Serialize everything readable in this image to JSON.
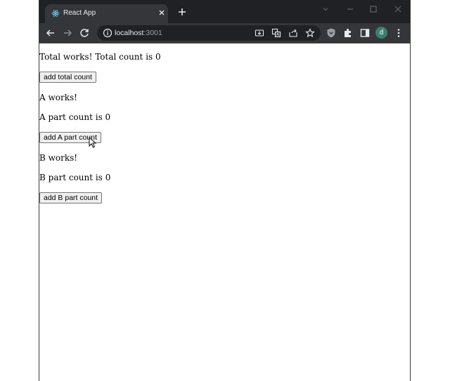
{
  "browser": {
    "tab": {
      "title": "React App"
    },
    "address": {
      "host": "localhost",
      "port": ":3001"
    },
    "profile": {
      "initial": "d",
      "color": "#3a7f6f"
    },
    "theme": {
      "frame": "#202124",
      "toolbar": "#35363a",
      "text": "#e8eaed"
    }
  },
  "app": {
    "total_text": "Total works! Total count is 0",
    "total_button": "add total count",
    "a_works": "A works!",
    "a_count_text": "A part count is 0",
    "a_button": "add A part count",
    "b_works": "B works!",
    "b_count_text": "B part count is 0",
    "b_button": "add B part count"
  },
  "icons": {
    "tab_favicon": "react-icon",
    "tab_close": "close-icon",
    "new_tab": "plus-icon",
    "back": "arrow-left-icon",
    "forward": "arrow-right-icon",
    "reload": "reload-icon",
    "site_info": "info-icon",
    "install": "install-icon",
    "translate": "translate-icon",
    "share": "share-icon",
    "bookmark": "star-icon",
    "shield": "shield-icon",
    "extensions": "puzzle-icon",
    "side_panel": "side-panel-icon",
    "menu": "kebab-menu-icon"
  }
}
